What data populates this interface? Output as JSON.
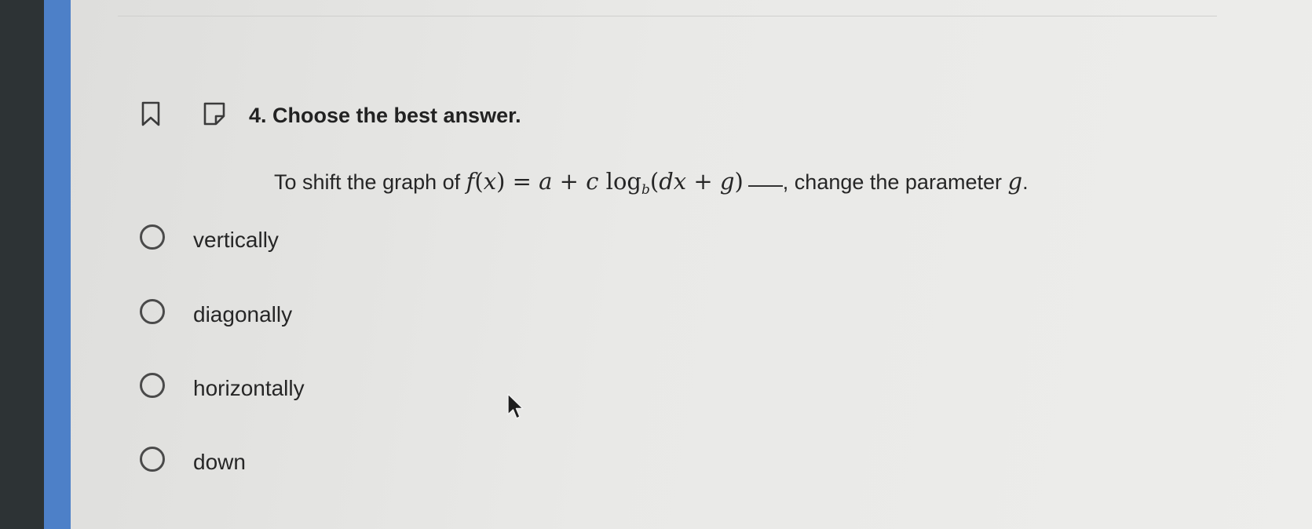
{
  "question": {
    "number_title": "4. Choose the best answer.",
    "stem_prefix": "To shift the graph of",
    "formula": {
      "f": "f",
      "x": "x",
      "a": "a",
      "c": "c",
      "log": "log",
      "base": "b",
      "d": "d",
      "g": "g"
    },
    "stem_suffix": ", change the parameter",
    "parameter": "g",
    "period": "."
  },
  "options": [
    {
      "label": "vertically",
      "selected": false
    },
    {
      "label": "diagonally",
      "selected": false
    },
    {
      "label": "horizontally",
      "selected": false
    },
    {
      "label": "down",
      "selected": false
    }
  ],
  "icons": {
    "bookmark": "bookmark-icon",
    "note": "note-icon",
    "radio": "radio-circle",
    "cursor": "arrow-cursor"
  },
  "colors": {
    "accent_bar": "#4d80c8",
    "bezel": "#2d3335",
    "background": "#e6e6e4"
  }
}
